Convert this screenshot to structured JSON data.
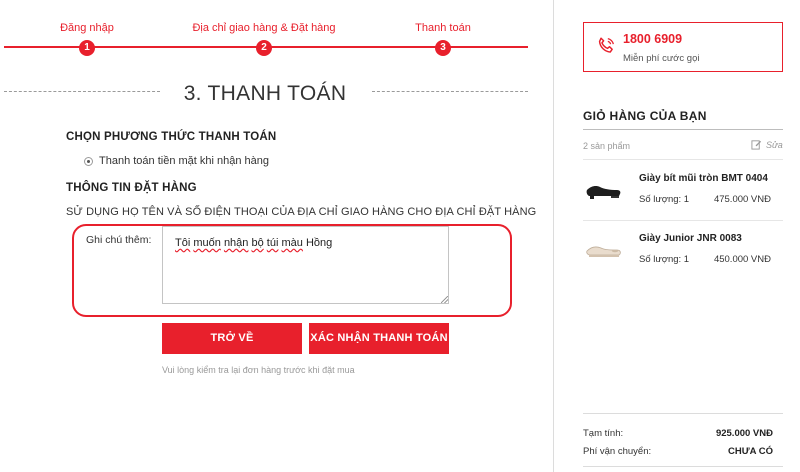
{
  "steps": [
    {
      "label": "Đăng nhập",
      "number": "1"
    },
    {
      "label": "Địa chỉ giao hàng & Đặt hàng",
      "number": "2"
    },
    {
      "label": "Thanh toán",
      "number": "3"
    }
  ],
  "page_title": "3. THANH TOÁN",
  "payment": {
    "title": "CHỌN PHƯƠNG THỨC THANH TOÁN",
    "option": "Thanh toán tiền mặt khi nhận hàng"
  },
  "order_info": {
    "title": "THÔNG TIN ĐẶT HÀNG",
    "notice": "SỬ DỤNG HỌ TÊN VÀ SỐ ĐIỆN THOẠI CỦA ĐỊA CHỈ GIAO HÀNG CHO ĐỊA CHỈ ĐẶT HÀNG",
    "note_label": "Ghi chú thêm:",
    "note_value_words": [
      "Tôi",
      "muốn",
      "nhận",
      "bộ",
      "túi",
      "màu",
      "Hồng"
    ]
  },
  "buttons": {
    "back": "TRỞ VỀ",
    "confirm": "XÁC NHẬN THANH TOÁN"
  },
  "hint": "Vui lòng kiểm tra lại đơn hàng trước khi đặt mua",
  "hotline": {
    "number": "1800 6909",
    "sub": "Miễn phí cước gọi"
  },
  "cart": {
    "title": "GIỎ HÀNG CỦA BẠN",
    "count": "2 sản phẩm",
    "edit": "Sửa",
    "items": [
      {
        "name": "Giày bít mũi tròn BMT 0404",
        "qty": "Số lượng: 1",
        "price": "475.000 VNĐ",
        "icon": "black-shoe-icon"
      },
      {
        "name": "Giày Junior JNR 0083",
        "qty": "Số lượng: 1",
        "price": "450.000 VNĐ",
        "icon": "beige-shoe-icon"
      }
    ],
    "subtotal_label": "Tạm tính:",
    "subtotal_value": "925.000 VNĐ",
    "shipping_label": "Phí vận chuyển:",
    "shipping_value": "CHƯA CÓ"
  },
  "colors": {
    "accent": "#e8202c"
  }
}
